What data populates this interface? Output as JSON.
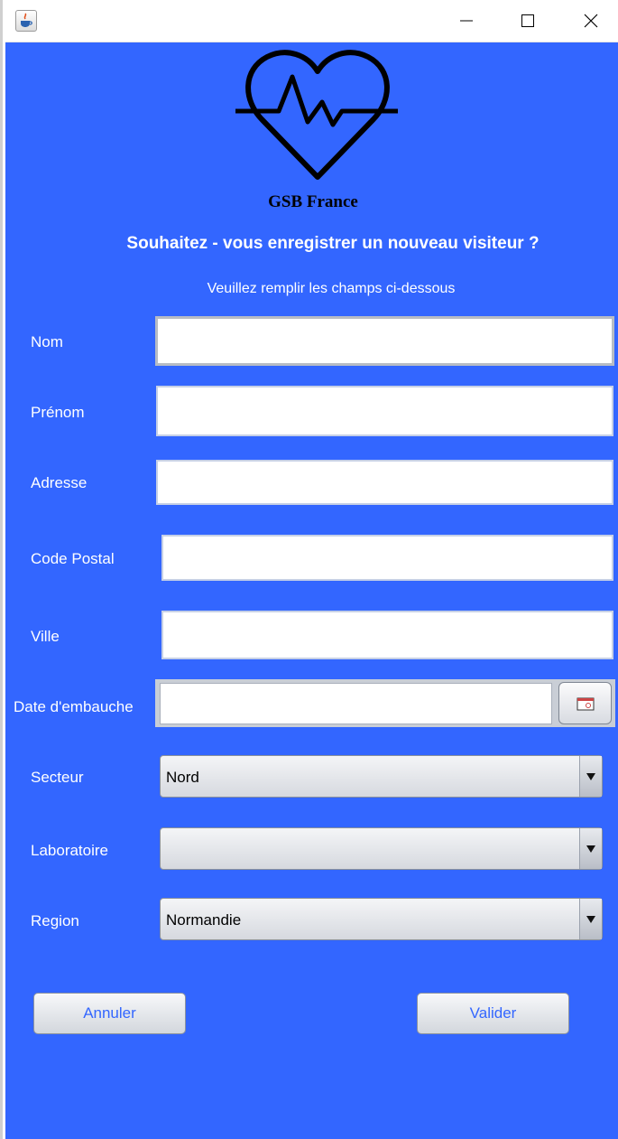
{
  "window": {
    "icon": "java-coffee-icon",
    "controls": [
      "minimize-icon",
      "maximize-icon",
      "close-icon"
    ]
  },
  "header": {
    "logo": "heart-pulse-icon",
    "brand": "GSB France",
    "question": "Souhaitez - vous enregistrer un nouveau visiteur ?",
    "instructions": "Veuillez remplir les champs ci-dessous"
  },
  "form": {
    "nom": {
      "label": "Nom",
      "value": ""
    },
    "prenom": {
      "label": "Prénom",
      "value": ""
    },
    "adresse": {
      "label": "Adresse",
      "value": ""
    },
    "code_postal": {
      "label": "Code Postal",
      "value": ""
    },
    "ville": {
      "label": "Ville",
      "value": ""
    },
    "date_embauche": {
      "label": "Date d'embauche",
      "value": "",
      "picker_icon": "calendar-icon"
    },
    "secteur": {
      "label": "Secteur",
      "selected": "Nord"
    },
    "laboratoire": {
      "label": "Laboratoire",
      "selected": ""
    },
    "region": {
      "label": "Region",
      "selected": "Normandie"
    }
  },
  "actions": {
    "cancel": "Annuler",
    "submit": "Valider"
  },
  "colors": {
    "background": "#3366ff",
    "button_text": "#3366ff",
    "label_text": "#ffffff"
  }
}
